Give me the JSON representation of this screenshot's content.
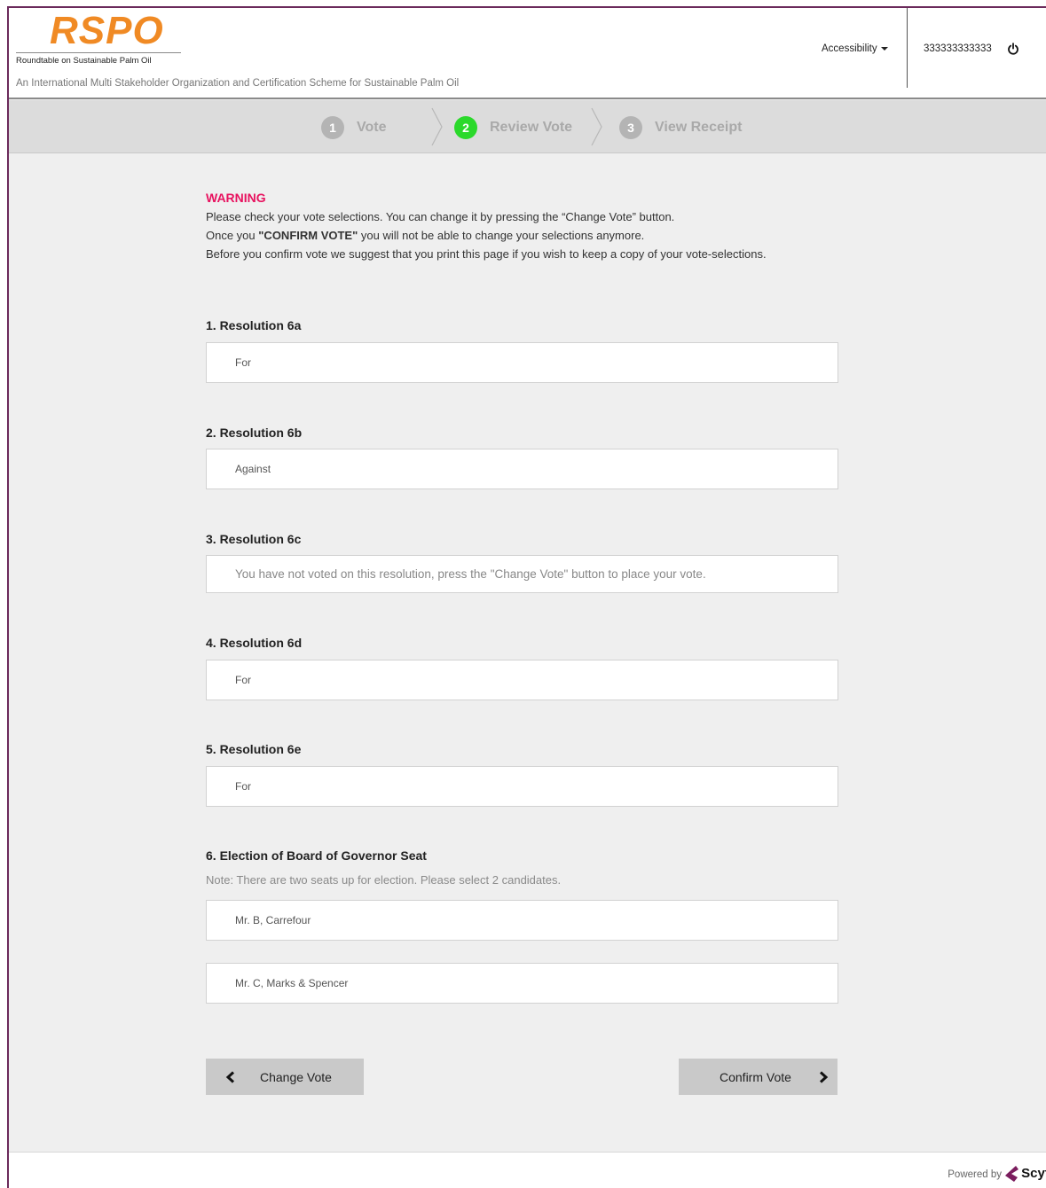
{
  "header": {
    "logo_text": "RSPO",
    "logo_subtitle": "Roundtable on Sustainable Palm Oil",
    "tagline": "An International Multi Stakeholder Organization and Certification Scheme for Sustainable Palm Oil",
    "accessibility_label": "Accessibility",
    "user_id": "333333333333",
    "brand_color": "#f08a24"
  },
  "stepper": {
    "steps": [
      {
        "num": "1",
        "label": "Vote",
        "state": "inactive"
      },
      {
        "num": "2",
        "label": "Review Vote",
        "state": "active"
      },
      {
        "num": "3",
        "label": "View Receipt",
        "state": "inactive"
      }
    ]
  },
  "warning": {
    "title": "WARNING",
    "line1": "Please check your vote selections. You can change it by pressing the “Change Vote” button.",
    "line2_pre": "Once you ",
    "line2_bold": "\"CONFIRM VOTE\"",
    "line2_post": " you will not be able to change your selections anymore.",
    "line3": "Before you confirm vote we suggest that you print this page if you wish to keep a copy of your vote-selections.",
    "color": "#e8125f"
  },
  "questions": [
    {
      "title": "1. Resolution 6a",
      "answer": "For"
    },
    {
      "title": "2. Resolution 6b",
      "answer": "Against"
    },
    {
      "title": "3. Resolution 6c",
      "answer": "You have not voted on this resolution, press the \"Change Vote\" button to place your vote."
    },
    {
      "title": "4. Resolution 6d",
      "answer": "For"
    },
    {
      "title": "5. Resolution 6e",
      "answer": "For"
    },
    {
      "title": "6. Election of Board of Governor Seat",
      "note": "Note: There are two seats up for election. Please select 2 candidates.",
      "answers": [
        "Mr. B, Carrefour",
        "Mr. C, Marks & Spencer"
      ]
    }
  ],
  "buttons": {
    "change_vote": "Change Vote",
    "confirm_vote": "Confirm Vote"
  },
  "footer": {
    "powered_by": "Powered by",
    "brand": "Scytl"
  }
}
